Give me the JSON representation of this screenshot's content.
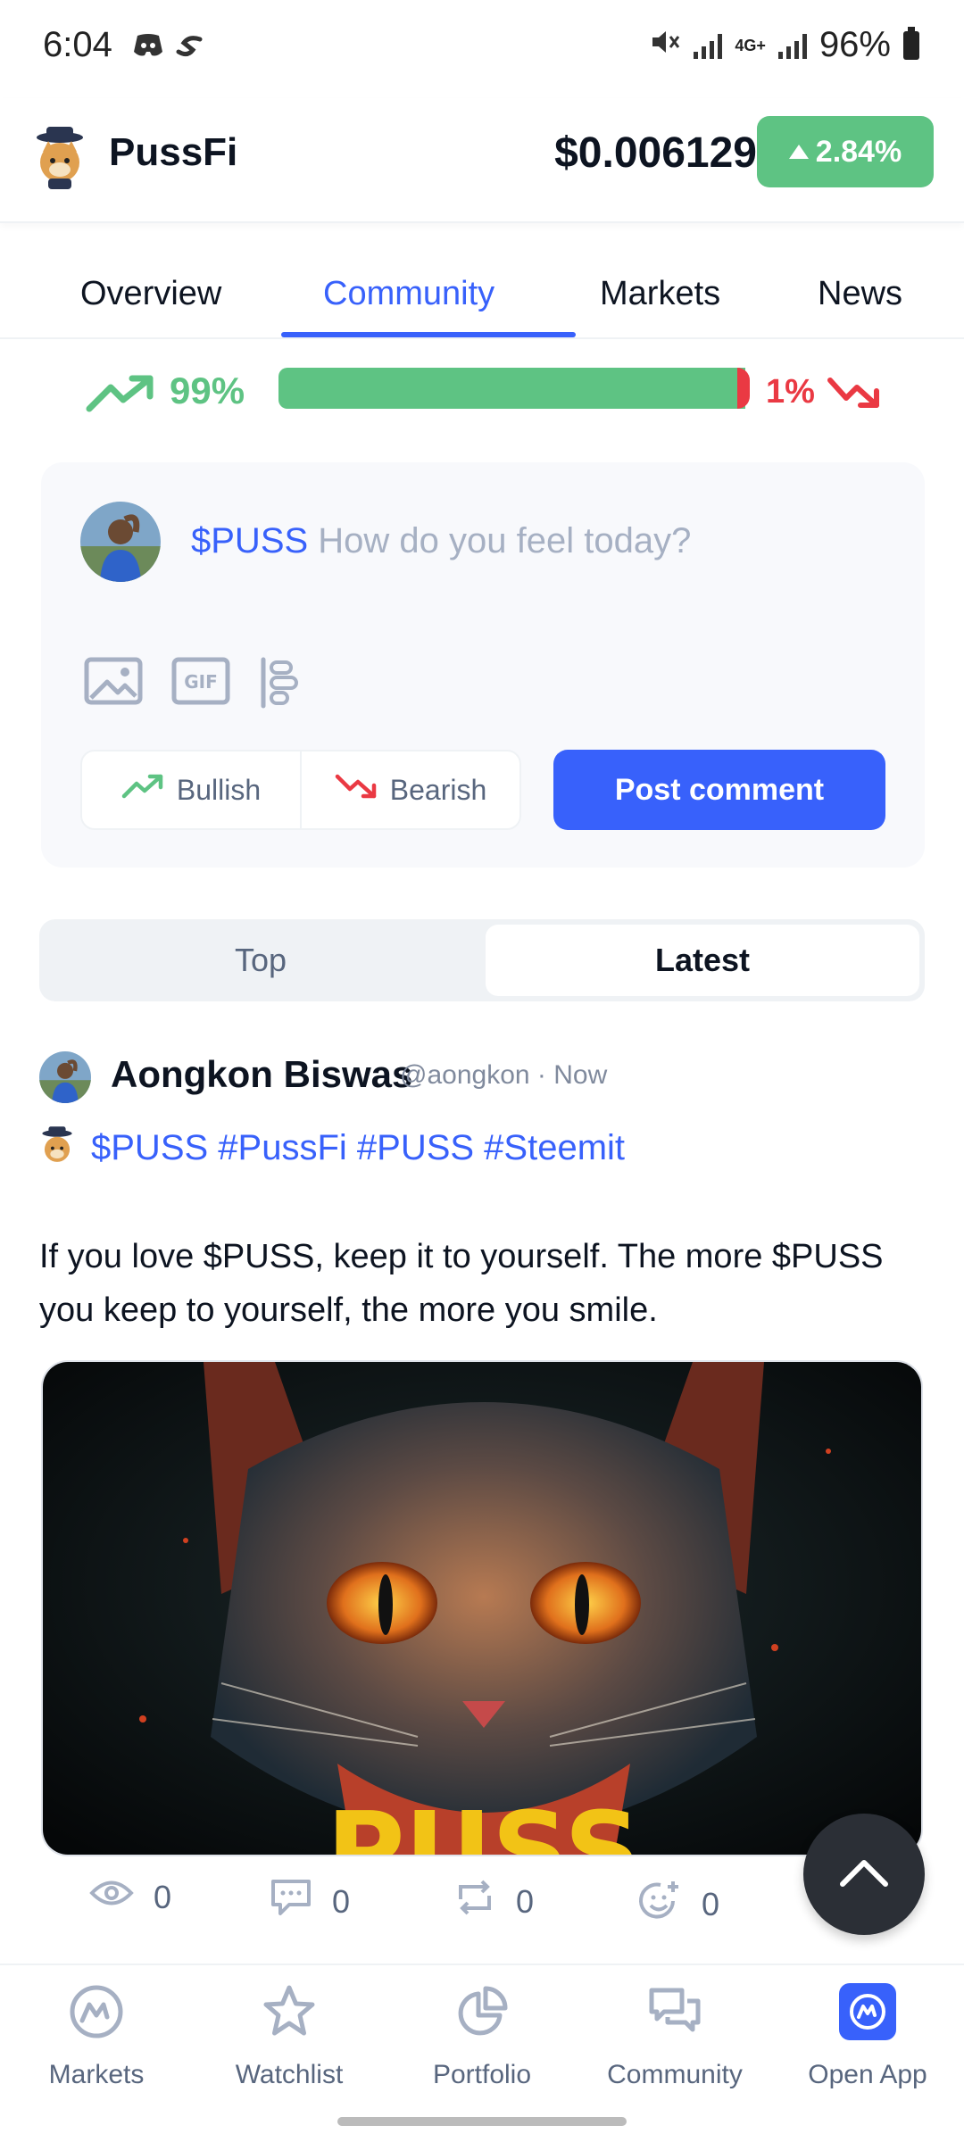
{
  "status_bar": {
    "time": "6:04",
    "battery": "96%",
    "network": "4G+"
  },
  "header": {
    "coin_name": "PussFi",
    "price": "$0.006129",
    "change": "2.84%"
  },
  "tabs": [
    {
      "label": "Overview"
    },
    {
      "label": "Community"
    },
    {
      "label": "Markets"
    },
    {
      "label": "News"
    }
  ],
  "sentiment": {
    "bullish_pct": "99%",
    "bearish_pct": "1%",
    "bullish_fraction": 0.99
  },
  "composer": {
    "ticker": "$PUSS",
    "placeholder": "How do you feel today?",
    "bullish_label": "Bullish",
    "bearish_label": "Bearish",
    "post_label": "Post comment"
  },
  "sort": {
    "top_label": "Top",
    "latest_label": "Latest"
  },
  "post": {
    "author": "Aongkon Biswas",
    "handle": "@aongkon",
    "time": "Now",
    "tags": "$PUSS #PussFi #PUSS #Steemit",
    "body": "If you love $PUSS, keep it to yourself. The more $PUSS you keep to yourself, the more you smile.",
    "image_text": "PUSS",
    "stats": {
      "views": "0",
      "comments": "0",
      "reposts": "0",
      "reactions": "0"
    }
  },
  "bottom_nav": [
    {
      "label": "Markets"
    },
    {
      "label": "Watchlist"
    },
    {
      "label": "Portfolio"
    },
    {
      "label": "Community"
    },
    {
      "label": "Open App"
    }
  ],
  "colors": {
    "accent": "#3861fb",
    "bullish": "#5ec383",
    "bearish": "#ea3943"
  }
}
